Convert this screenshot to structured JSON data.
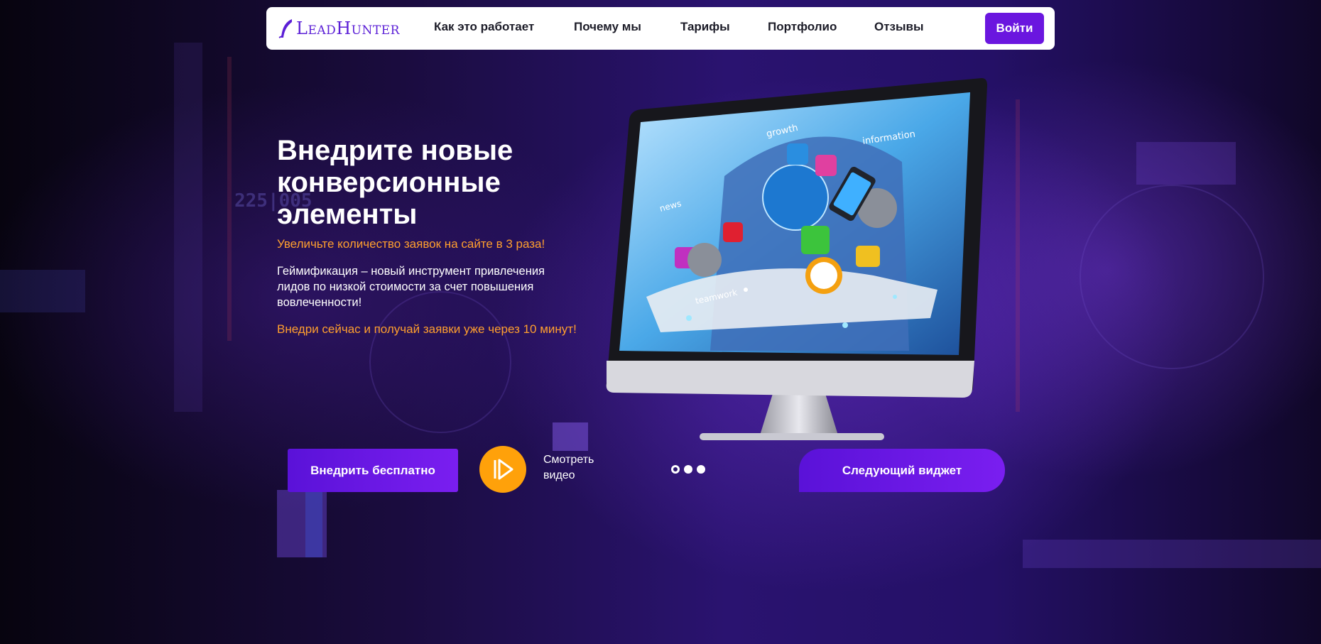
{
  "header": {
    "logo_text": "LeadHunter",
    "nav": [
      {
        "label": "Как это работает"
      },
      {
        "label": "Почему мы"
      },
      {
        "label": "Тарифы"
      },
      {
        "label": "Портфолио"
      },
      {
        "label": "Отзывы"
      }
    ],
    "login_label": "Войти"
  },
  "hero": {
    "title": "Внедрите новые конверсионные элементы",
    "subtitle": "Увеличьте количество заявок на сайте в 3 раза!",
    "description": "Геймификация – новый инструмент привлечения лидов по низкой стоимости за счет повышения вовлеченности!",
    "cta_text": "Внедри сейчас и получай заявки уже через 10 минут!"
  },
  "monitor_screen_words": [
    "growth",
    "information",
    "news",
    "teamwork"
  ],
  "controls": {
    "primary_button": "Внедрить бесплатно",
    "watch_video": "Смотреть видео",
    "next_widget": "Следующий виджет",
    "slides_total": 3,
    "slide_active": 1
  },
  "colors": {
    "accent_purple": "#6a16df",
    "accent_orange": "#ffa10a",
    "text_orange": "#ff9f2e"
  }
}
